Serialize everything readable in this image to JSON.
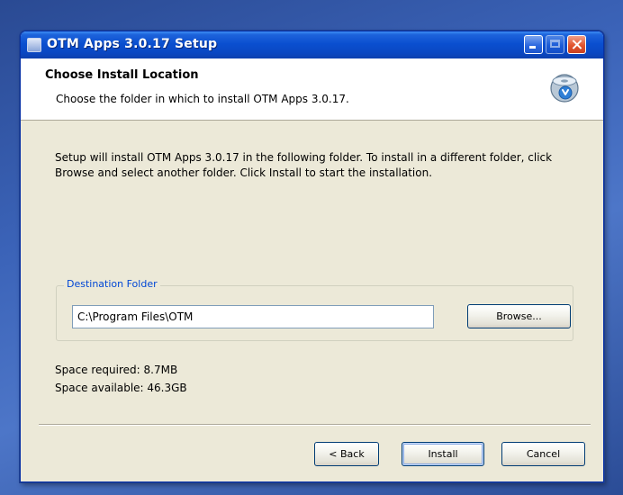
{
  "window": {
    "title": "OTM Apps 3.0.17 Setup"
  },
  "header": {
    "title": "Choose Install Location",
    "subtitle": "Choose the folder in which to install OTM Apps 3.0.17."
  },
  "body": {
    "instructions": "Setup will install OTM Apps 3.0.17 in the following folder. To install in a different folder, click Browse and select another folder. Click Install to start the installation."
  },
  "destination": {
    "group_label": "Destination Folder",
    "path_value": "C:\\Program Files\\OTM",
    "browse_label": "Browse..."
  },
  "space": {
    "required": "Space required: 8.7MB",
    "available": "Space available: 46.3GB"
  },
  "buttons": {
    "back": "< Back",
    "install": "Install",
    "cancel": "Cancel"
  },
  "colors": {
    "titlebar": "#0a4fd0",
    "dialog_bg": "#ece9d8",
    "group_label": "#0046d5",
    "close_button": "#e2552f"
  },
  "icons": {
    "title": "installer-icon",
    "header": "install-disk-icon"
  }
}
